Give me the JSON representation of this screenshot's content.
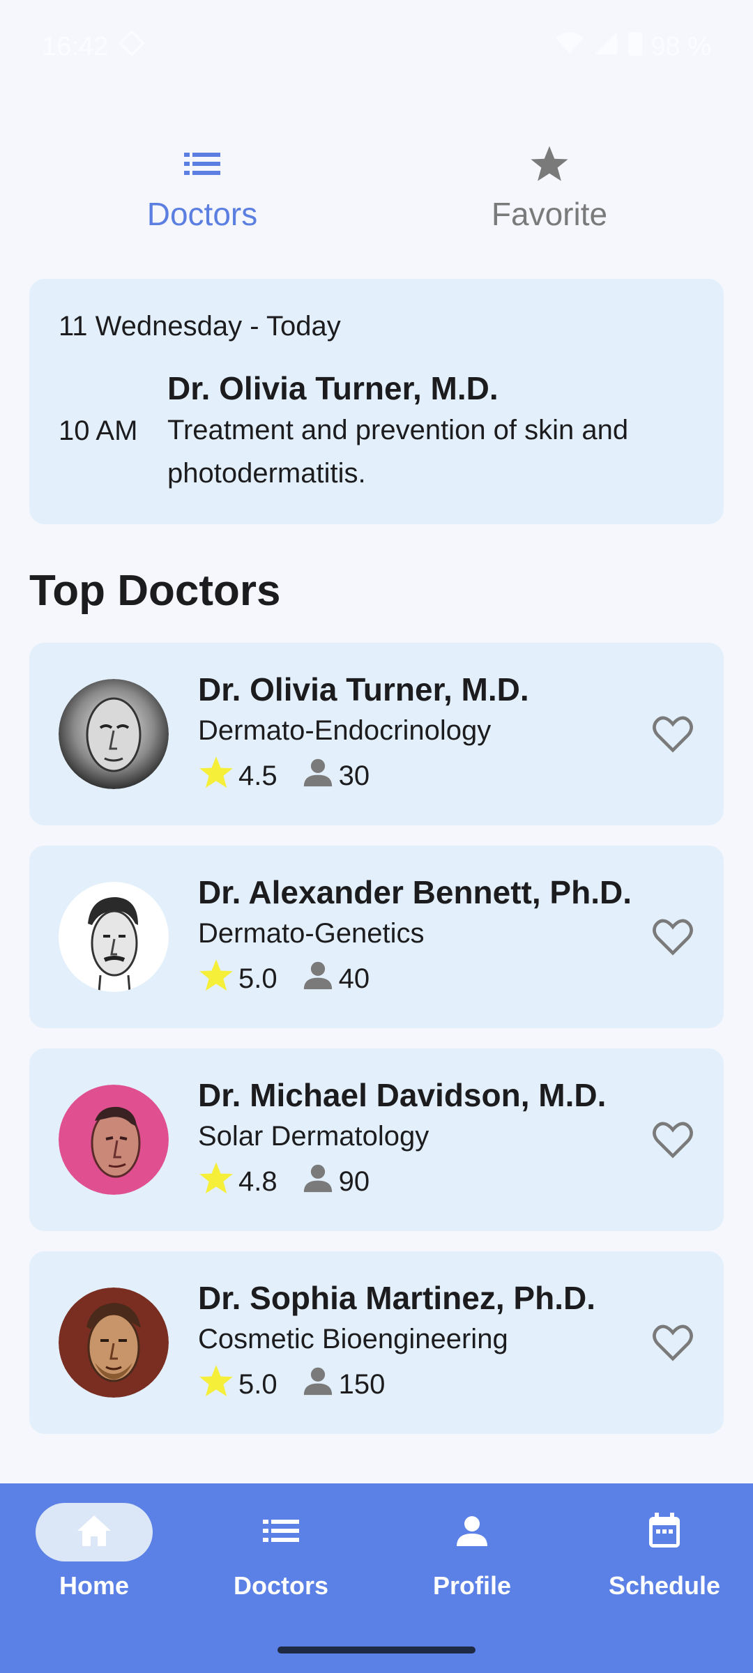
{
  "status": {
    "time": "16:42",
    "battery": "98 %"
  },
  "tabs": [
    {
      "label": "Doctors",
      "icon": "list-icon",
      "active": true
    },
    {
      "label": "Favorite",
      "icon": "star-icon",
      "active": false
    }
  ],
  "appointment": {
    "date": "11 Wednesday - Today",
    "time": "10 AM",
    "doctor": "Dr. Olivia Turner, M.D.",
    "description": "Treatment and prevention of skin and photodermatitis."
  },
  "section_title": "Top Doctors",
  "doctors": [
    {
      "name": "Dr. Olivia Turner, M.D.",
      "specialty": "Dermato-Endocrinology",
      "rating": "4.5",
      "patients": "30"
    },
    {
      "name": "Dr. Alexander Bennett, Ph.D.",
      "specialty": "Dermato-Genetics",
      "rating": "5.0",
      "patients": "40"
    },
    {
      "name": "Dr. Michael Davidson, M.D.",
      "specialty": "Solar Dermatology",
      "rating": "4.8",
      "patients": "90"
    },
    {
      "name": "Dr. Sophia Martinez, Ph.D.",
      "specialty": "Cosmetic Bioengineering",
      "rating": "5.0",
      "patients": "150"
    }
  ],
  "bottom_nav": [
    {
      "label": "Home",
      "icon": "home-icon",
      "active": true
    },
    {
      "label": "Doctors",
      "icon": "list-icon",
      "active": false
    },
    {
      "label": "Profile",
      "icon": "person-icon",
      "active": false
    },
    {
      "label": "Schedule",
      "icon": "calendar-icon",
      "active": false
    }
  ],
  "colors": {
    "accent": "#5b80e6",
    "card": "#e3f0fb",
    "star": "#f5ef3a",
    "inactive": "#7a7a7a"
  }
}
